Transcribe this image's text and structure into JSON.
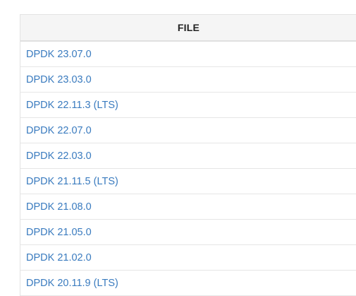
{
  "table": {
    "header": "FILE",
    "rows": [
      "DPDK 23.07.0",
      "DPDK 23.03.0",
      "DPDK 22.11.3 (LTS)",
      "DPDK 22.07.0",
      "DPDK 22.03.0",
      "DPDK 21.11.5 (LTS)",
      "DPDK 21.08.0",
      "DPDK 21.05.0",
      "DPDK 21.02.0",
      "DPDK 20.11.9 (LTS)"
    ]
  },
  "colors": {
    "link": "#3a7bbf",
    "header_bg": "#f5f5f5",
    "header_text": "#222222",
    "border": "#e6e6e6"
  }
}
